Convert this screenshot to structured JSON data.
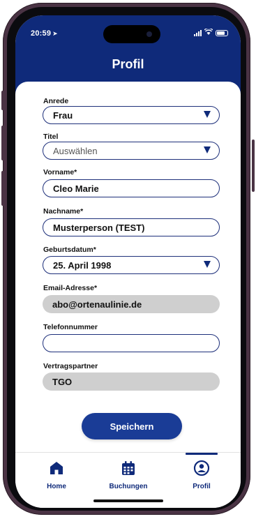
{
  "status_bar": {
    "time": "20:59",
    "location_icon": "location-arrow-icon",
    "signal_icon": "cellular-signal-icon",
    "wifi_icon": "wifi-icon",
    "battery_icon": "battery-icon"
  },
  "header": {
    "title": "Profil",
    "background_color": "#0f2a7a"
  },
  "form": {
    "anrede": {
      "label": "Anrede",
      "value": "Frau"
    },
    "titel": {
      "label": "Titel",
      "value": "Auswählen"
    },
    "vorname": {
      "label": "Vorname*",
      "value": "Cleo Marie"
    },
    "nachname": {
      "label": "Nachname*",
      "value": "Musterperson (TEST)"
    },
    "geburtsdatum": {
      "label": "Geburtsdatum*",
      "value": "25. April 1998"
    },
    "email": {
      "label": "Email-Adresse*",
      "value": "abo@ortenaulinie.de"
    },
    "telefon": {
      "label": "Telefonnummer",
      "value": ""
    },
    "vertragspartner": {
      "label": "Vertragspartner",
      "value": "TGO"
    }
  },
  "actions": {
    "save_label": "Speichern",
    "save_color": "#1a3c96"
  },
  "tabbar": {
    "tabs": [
      {
        "label": "Home",
        "icon": "home-icon",
        "active": false
      },
      {
        "label": "Buchungen",
        "icon": "calendar-icon",
        "active": false
      },
      {
        "label": "Profil",
        "icon": "user-circle-icon",
        "active": true
      }
    ],
    "accent_color": "#0f2a7a"
  }
}
